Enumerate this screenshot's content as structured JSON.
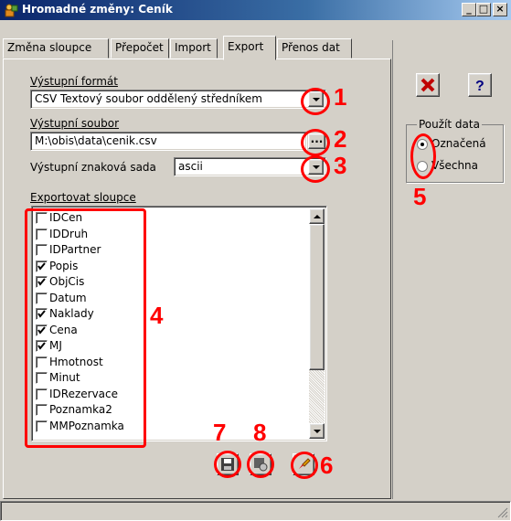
{
  "window": {
    "title": "Hromadné změny: Ceník",
    "controls": [
      "_",
      "□",
      "×"
    ]
  },
  "tabs": [
    {
      "label": "Změna sloupce",
      "active": false
    },
    {
      "label": "Přepočet",
      "active": false
    },
    {
      "label": "Import",
      "active": false
    },
    {
      "label": "Export",
      "active": true
    },
    {
      "label": "Přenos dat",
      "active": false
    }
  ],
  "export": {
    "format_label": "Výstupní formát",
    "format_value": "CSV Textový soubor oddělený středníkem",
    "file_label": "Výstupní soubor",
    "file_value": "M:\\obis\\data\\cenik.csv",
    "browse_label": "...",
    "charset_label": "Výstupní znaková sada",
    "charset_value": "ascii",
    "columns_label": "Exportovat sloupce",
    "columns": [
      {
        "name": "IDCen",
        "checked": false
      },
      {
        "name": "IDDruh",
        "checked": false
      },
      {
        "name": "IDPartner",
        "checked": false
      },
      {
        "name": "Popis",
        "checked": true
      },
      {
        "name": "ObjCis",
        "checked": true
      },
      {
        "name": "Datum",
        "checked": false
      },
      {
        "name": "Naklady",
        "checked": true
      },
      {
        "name": "Cena",
        "checked": true
      },
      {
        "name": "MJ",
        "checked": true
      },
      {
        "name": "Hmotnost",
        "checked": false
      },
      {
        "name": "Minut",
        "checked": false
      },
      {
        "name": "IDRezervace",
        "checked": false
      },
      {
        "name": "Poznamka2",
        "checked": false
      },
      {
        "name": "MMPoznamka",
        "checked": false
      }
    ]
  },
  "side": {
    "group_label": "Použít data",
    "options": [
      {
        "label": "Označená",
        "selected": true
      },
      {
        "label": "Všechna",
        "selected": false
      }
    ]
  },
  "icons": {
    "cancel": "red-x-icon",
    "help": "question-icon",
    "save": "floppy-disk-icon",
    "load": "open-settings-icon",
    "run": "rocket-icon"
  },
  "annotations": [
    "1",
    "2",
    "3",
    "4",
    "5",
    "6",
    "7",
    "8"
  ],
  "colors": {
    "annotation": "#ff0000",
    "titlebar": "#0a246a"
  }
}
